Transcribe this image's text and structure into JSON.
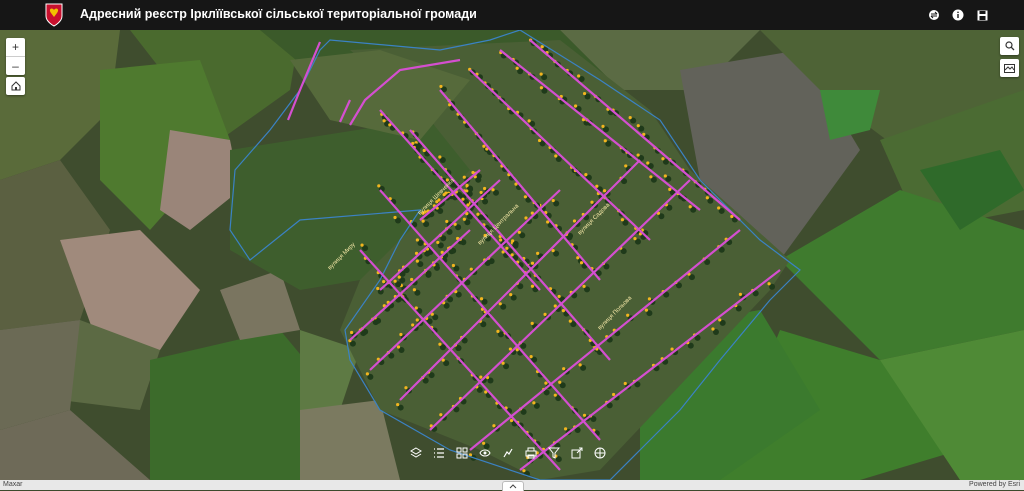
{
  "app": {
    "title": "Адресний реєстр Ірклїївської сільської територіальної громади",
    "accent": "#c8102e"
  },
  "header": {
    "buttons": [
      {
        "name": "layers-toggle",
        "icon": "swap-icon"
      },
      {
        "name": "info",
        "icon": "info-icon"
      },
      {
        "name": "save",
        "icon": "save-icon"
      }
    ]
  },
  "map_controls": {
    "zoom_in": "+",
    "zoom_out": "–",
    "home_icon": "home-icon",
    "search_icon": "search-icon",
    "basemap_icon": "basemap-icon"
  },
  "toolbar": {
    "tools": [
      "layers-icon",
      "legend-icon",
      "basemap-gallery-icon",
      "bookmark-icon",
      "analysis-icon",
      "print-icon",
      "filter-icon",
      "share-icon",
      "measure-icon"
    ]
  },
  "footer": {
    "attribution_left": "Maxar",
    "attribution_right": "Powered by Esri"
  },
  "map": {
    "street_color": "#d44fd0",
    "boundary_color": "#3b82c4",
    "street_labels": [
      "вулиця Миру",
      "вулиця Шевченка",
      "вулиця Центральна",
      "вулиця Садова",
      "вулиця Польова"
    ]
  }
}
